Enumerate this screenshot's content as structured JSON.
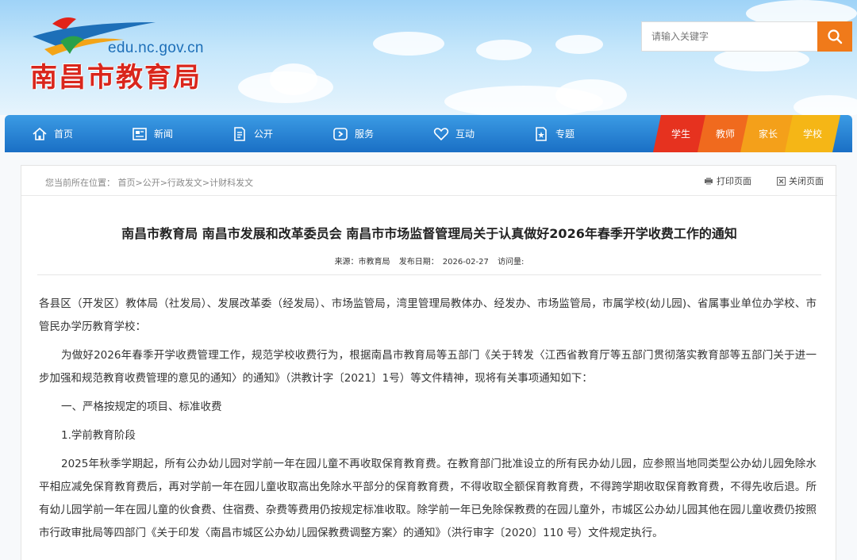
{
  "header": {
    "domain": "edu.nc.gov.cn",
    "site_title": "南昌市教育局",
    "search_placeholder": "请输入关键字",
    "search_icon": "search-icon"
  },
  "nav": {
    "items": [
      {
        "label": "首页",
        "icon": "home-icon"
      },
      {
        "label": "新闻",
        "icon": "news-icon"
      },
      {
        "label": "公开",
        "icon": "document-icon"
      },
      {
        "label": "服务",
        "icon": "service-icon"
      },
      {
        "label": "互动",
        "icon": "heart-icon"
      },
      {
        "label": "专题",
        "icon": "topic-icon"
      }
    ],
    "roles": [
      {
        "label": "学生",
        "color": "#e6321f"
      },
      {
        "label": "教师",
        "color": "#f06a1e"
      },
      {
        "label": "家长",
        "color": "#f4a01a"
      },
      {
        "label": "学校",
        "color": "#f5b616"
      }
    ]
  },
  "breadcrumb": {
    "prefix": "您当前所在位置：",
    "path": "首页>公开>行政发文>计财科发文"
  },
  "toolbar": {
    "print_label": "打印页面",
    "close_label": "关闭页面"
  },
  "article": {
    "title": "南昌市教育局 南昌市发展和改革委员会 南昌市市场监督管理局关于认真做好2026年春季开学收费工作的通知",
    "source": "来源：市教育局",
    "date": "发布日期：　2026-02-27",
    "views": "访问量:",
    "paragraphs": [
      "各县区（开发区）教体局（社发局）、发展改革委（经发局）、市场监管局，湾里管理局教体办、经发办、市场监管局，市属学校(幼儿园)、省属事业单位办学校、市管民办学历教育学校：",
      "为做好2026年春季开学收费管理工作，规范学校收费行为，根据南昌市教育局等五部门《关于转发〈江西省教育厅等五部门贯彻落实教育部等五部门关于进一步加强和规范教育收费管理的意见的通知〉的通知》（洪教计字〔2021〕1号）等文件精神，现将有关事项通知如下：",
      "一、严格按规定的项目、标准收费",
      "1.学前教育阶段",
      "2025年秋季学期起，所有公办幼儿园对学前一年在园儿童不再收取保育教育费。在教育部门批准设立的所有民办幼儿园，应参照当地同类型公办幼儿园免除水平相应减免保育教育费后，再对学前一年在园儿童收取高出免除水平部分的保育教育费，不得收取全额保育教育费，不得跨学期收取保育教育费，不得先收后退。所有幼儿园学前一年在园儿童的伙食费、住宿费、杂费等费用仍按规定标准收取。除学前一年已免除保教费的在园儿童外，市城区公办幼儿园其他在园儿童收费仍按照市行政审批局等四部门《关于印发〈南昌市城区公办幼儿园保教费调整方案〉的通知》（洪行审字〔2020〕110 号）文件规定执行。"
    ]
  }
}
